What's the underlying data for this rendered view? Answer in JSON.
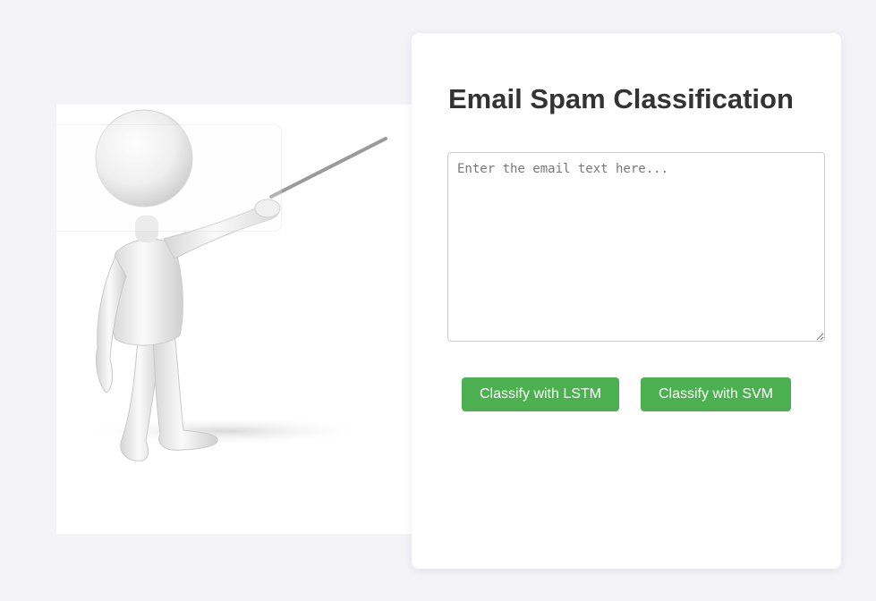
{
  "card": {
    "title": "Email Spam Classification",
    "textarea": {
      "placeholder": "Enter the email text here...",
      "value": ""
    },
    "buttons": {
      "lstm_label": "Classify with LSTM",
      "svm_label": "Classify with SVM"
    },
    "button_color": "#4caf50"
  },
  "illustration": {
    "icon": "stick-figure-presenter-with-pointer"
  },
  "colors": {
    "page_background": "#f3f3f8",
    "card_background": "#ffffff",
    "title_color": "#333333"
  }
}
